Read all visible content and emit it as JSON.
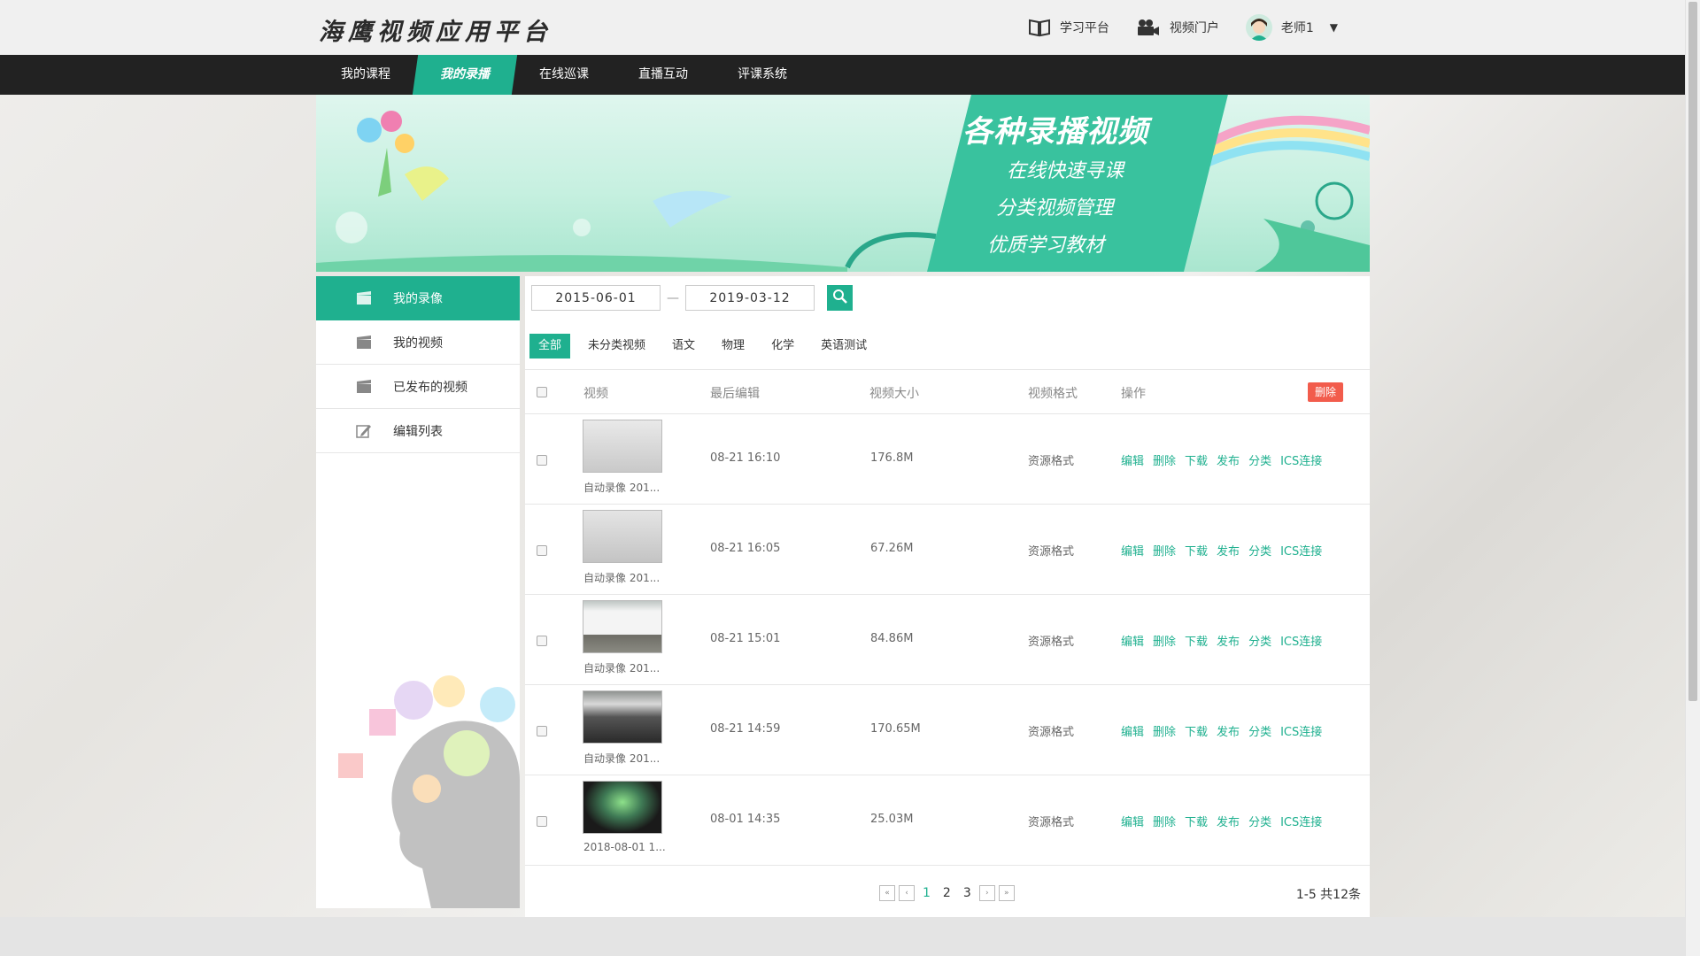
{
  "header": {
    "logo": "海鹰视频应用平台",
    "study_platform": "学习平台",
    "video_portal": "视频门户",
    "user_name": "老师1",
    "caret": "▼"
  },
  "nav": {
    "items": [
      "我的课程",
      "我的录播",
      "在线巡课",
      "直播互动",
      "评课系统"
    ]
  },
  "banner": {
    "title": "各种录播视频",
    "line1": "在线快速寻课",
    "line2": "分类视频管理",
    "line3": "优质学习教材"
  },
  "sidebar": {
    "items": [
      "我的录像",
      "我的视频",
      "已发布的视频",
      "编辑列表"
    ]
  },
  "filters": {
    "start_date": "2015-06-01",
    "end_date": "2019-03-12",
    "dash": "—"
  },
  "tabs": [
    "全部",
    "未分类视频",
    "语文",
    "物理",
    "化学",
    "英语测试"
  ],
  "table": {
    "headers": {
      "video": "视频",
      "last_edit": "最后编辑",
      "size": "视频大小",
      "format": "视频格式",
      "action": "操作",
      "delete": "删除"
    },
    "ops": [
      "编辑",
      "删除",
      "下载",
      "发布",
      "分类",
      "ICS连接"
    ],
    "rows": [
      {
        "name": "自动录像 201...",
        "time": "08-21 16:10",
        "size": "176.8M",
        "format": "资源格式"
      },
      {
        "name": "自动录像 201...",
        "time": "08-21 16:05",
        "size": "67.26M",
        "format": "资源格式"
      },
      {
        "name": "自动录像 201...",
        "time": "08-21 15:01",
        "size": "84.86M",
        "format": "资源格式"
      },
      {
        "name": "自动录像 201...",
        "time": "08-21 14:59",
        "size": "170.65M",
        "format": "资源格式"
      },
      {
        "name": "2018-08-01 1...",
        "time": "08-01 14:35",
        "size": "25.03M",
        "format": "资源格式"
      }
    ]
  },
  "pager": {
    "pages": [
      "1",
      "2",
      "3"
    ],
    "total": "1-5 共12条"
  },
  "colors": {
    "accent": "#1fb08f",
    "danger": "#f25c4c",
    "nav_bg": "#222222"
  }
}
